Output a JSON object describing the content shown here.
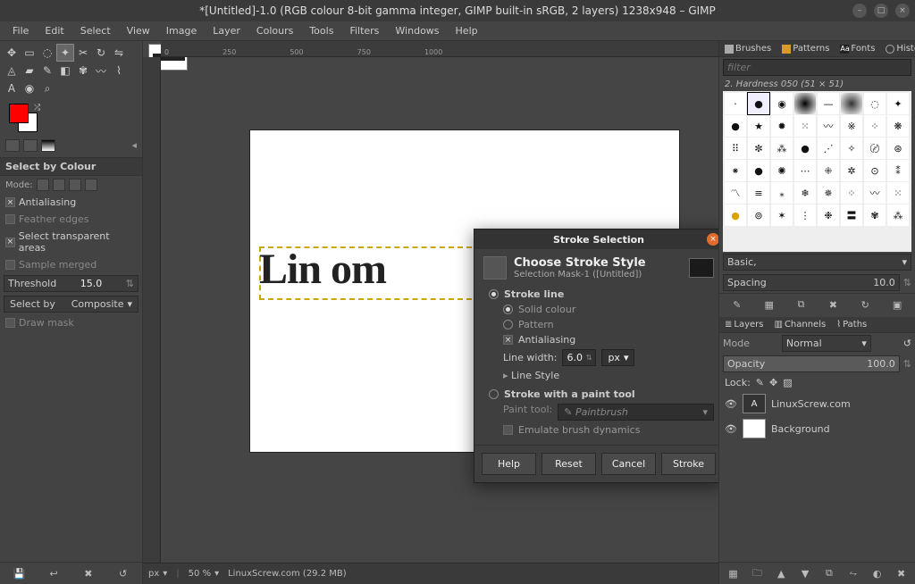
{
  "window": {
    "title": "*[Untitled]-1.0 (RGB colour 8-bit gamma integer, GIMP built-in sRGB, 2 layers) 1238x948 – GIMP"
  },
  "menu": [
    "File",
    "Edit",
    "Select",
    "View",
    "Image",
    "Layer",
    "Colours",
    "Tools",
    "Filters",
    "Windows",
    "Help"
  ],
  "tool_options": {
    "title": "Select by Colour",
    "mode_label": "Mode:",
    "antialiasing": "Antialiasing",
    "feather": "Feather edges",
    "transparent": "Select transparent areas",
    "sample_merged": "Sample merged",
    "threshold_label": "Threshold",
    "threshold_value": "15.0",
    "selectby_label": "Select by",
    "selectby_value": "Composite",
    "draw_mask": "Draw mask"
  },
  "canvas": {
    "text": "Lin                   om"
  },
  "dialog": {
    "title": "Stroke Selection",
    "heading": "Choose Stroke Style",
    "subheading": "Selection Mask-1 ([Untitled])",
    "stroke_line": "Stroke line",
    "solid_colour": "Solid colour",
    "pattern": "Pattern",
    "antialiasing": "Antialiasing",
    "line_width_label": "Line width:",
    "line_width_value": "6.0",
    "line_width_unit": "px",
    "line_style": "Line Style",
    "stroke_paint": "Stroke with a paint tool",
    "paint_tool_label": "Paint tool:",
    "paint_tool_value": "Paintbrush",
    "emulate": "Emulate brush dynamics",
    "buttons": {
      "help": "Help",
      "reset": "Reset",
      "cancel": "Cancel",
      "stroke": "Stroke"
    }
  },
  "dock": {
    "tabs": {
      "brushes": "Brushes",
      "patterns": "Patterns",
      "fonts": "Fonts",
      "history": "History"
    },
    "filter_placeholder": "filter",
    "brush_info": "2. Hardness 050 (51 × 51)",
    "basic_label": "Basic,",
    "spacing_label": "Spacing",
    "spacing_value": "10.0"
  },
  "layers_dock": {
    "tabs": {
      "layers": "Layers",
      "channels": "Channels",
      "paths": "Paths"
    },
    "mode_label": "Mode",
    "mode_value": "Normal",
    "opacity_label": "Opacity",
    "opacity_value": "100.0",
    "lock_label": "Lock:",
    "layers": [
      {
        "name": "LinuxScrew.com",
        "thumb": "text"
      },
      {
        "name": "Background",
        "thumb": "white"
      }
    ]
  },
  "status": {
    "unit": "px",
    "zoom": "50 %",
    "info": "LinuxScrew.com (29.2 MB)"
  },
  "ruler_marks": [
    "0",
    "250",
    "500",
    "750",
    "1000"
  ]
}
